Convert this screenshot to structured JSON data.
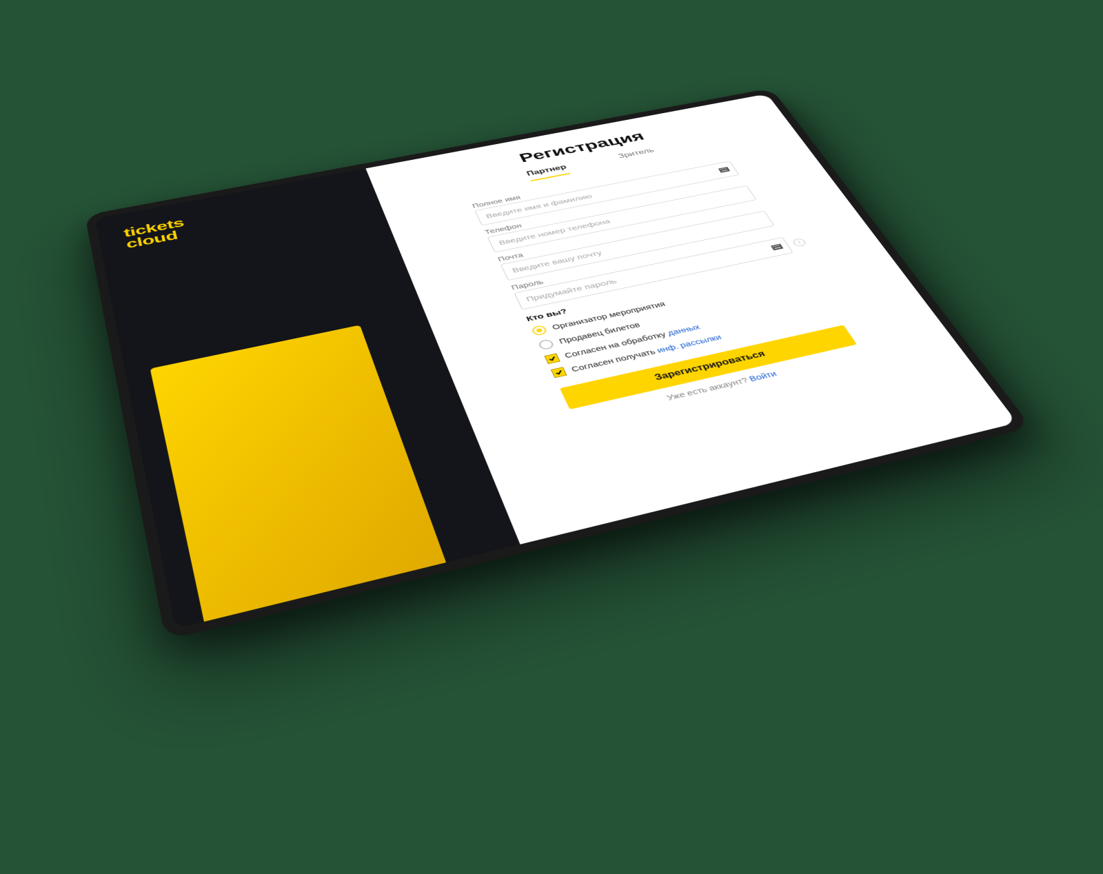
{
  "brand": {
    "line1": "tickets",
    "line2": "cloud"
  },
  "title": "Регистрация",
  "tabs": {
    "partner": "Партнер",
    "spectator": "Зритель"
  },
  "fields": {
    "fullname": {
      "label": "Полное имя",
      "placeholder": "Введите имя и фамилию"
    },
    "phone": {
      "label": "Телефон",
      "placeholder": "Введите номер телефона"
    },
    "email": {
      "label": "Почта",
      "placeholder": "Введите вашу почту"
    },
    "password": {
      "label": "Пароль",
      "placeholder": "Придумайте пароль"
    }
  },
  "role": {
    "question": "Кто вы?",
    "organizer": "Организатор мероприятия",
    "seller": "Продавец билетов"
  },
  "consent": {
    "data_prefix": "Согласен на обработку ",
    "data_link": "данных",
    "mail_prefix": "Согласен получать ",
    "mail_link": "инф. рассылки"
  },
  "submit": "Зарегистрироваться",
  "footer": {
    "text": "Уже есть аккаунт? ",
    "link": "Войти"
  },
  "colors": {
    "accent": "#ffd500",
    "bg_dark": "#14151a",
    "page_bg": "#245336",
    "link": "#1a5fd6"
  }
}
